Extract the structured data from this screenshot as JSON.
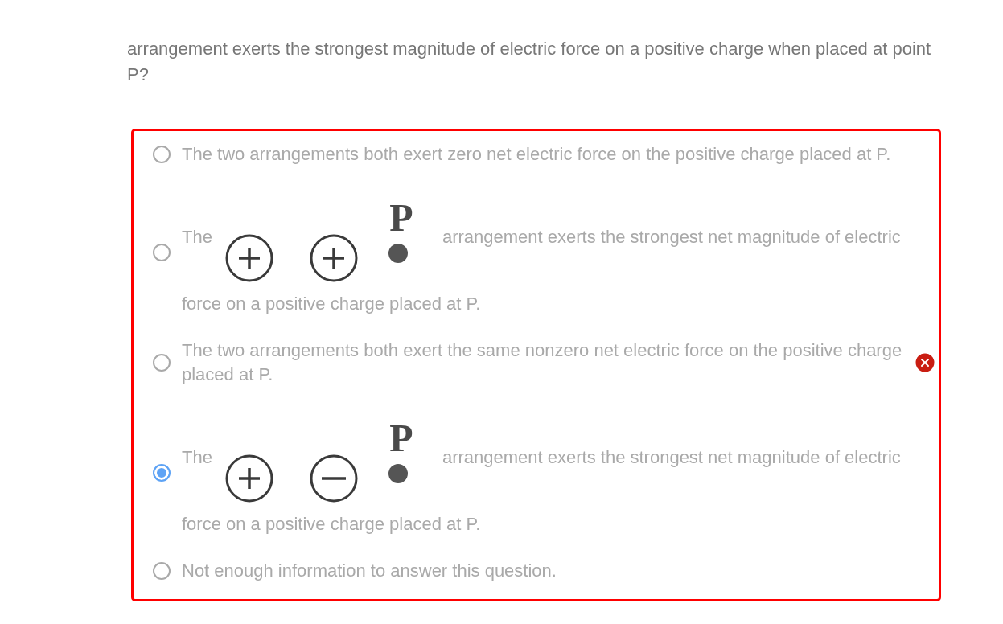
{
  "question": {
    "text": "arrangement exerts the strongest magnitude of electric force on a positive charge when placed at point P?"
  },
  "options": [
    {
      "kind": "text",
      "selected": false,
      "text": "The two arrangements both exert zero net electric force on the positive charge placed at P."
    },
    {
      "kind": "diagram",
      "selected": false,
      "text_before": "The",
      "charges": [
        {
          "kind": "positive"
        },
        {
          "kind": "positive"
        }
      ],
      "point_label": "P",
      "text_after": "arrangement exerts the strongest net magnitude of electric",
      "text_continued": "force on a positive charge placed at P."
    },
    {
      "kind": "text",
      "selected": false,
      "text": "The two arrangements both exert the same nonzero net electric force on the positive charge placed at P."
    },
    {
      "kind": "diagram",
      "selected": true,
      "text_before": "The",
      "charges": [
        {
          "kind": "positive"
        },
        {
          "kind": "negative"
        }
      ],
      "point_label": "P",
      "text_after": "arrangement exerts the strongest net magnitude of electric",
      "text_continued": "force on a positive charge placed at P."
    },
    {
      "kind": "text",
      "selected": false,
      "text": "Not enough information to answer this question."
    }
  ],
  "result": {
    "correct": false
  }
}
